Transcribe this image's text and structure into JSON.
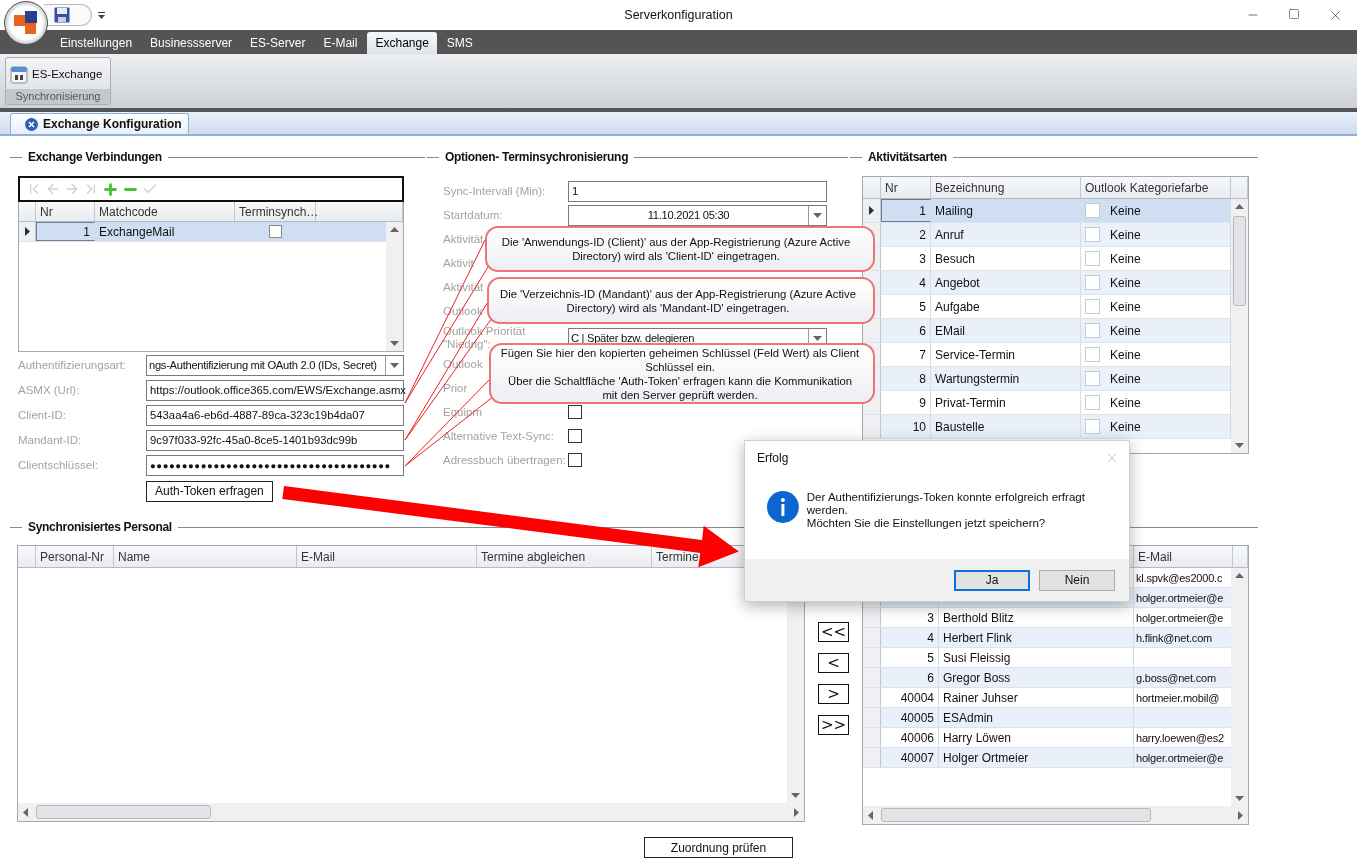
{
  "window": {
    "title": "Serverkonfiguration"
  },
  "ribbon": {
    "tabs": [
      {
        "label": "Einstellungen",
        "selected": false
      },
      {
        "label": "Businessserver",
        "selected": false
      },
      {
        "label": "ES-Server",
        "selected": false
      },
      {
        "label": "E-Mail",
        "selected": false
      },
      {
        "label": "Exchange",
        "selected": true
      },
      {
        "label": "SMS",
        "selected": false
      }
    ],
    "group": {
      "label": "Synchronisierung",
      "button": "ES-Exchange"
    }
  },
  "document_tabs": [
    {
      "label": "Exchange Konfiguration",
      "selected": true
    }
  ],
  "exchange_connections": {
    "title": "Exchange Verbindungen",
    "columns": [
      "Nr",
      "Matchcode",
      "Terminsynch…"
    ],
    "rows": [
      {
        "nr": "1",
        "matchcode": "ExchangeMail",
        "terminsync": false,
        "selected": true
      }
    ]
  },
  "connection_fields": [
    {
      "label": "Authentifizierungsart:",
      "kind": "dropdown",
      "value": "ngs-Authentifizierung mit OAuth 2.0 (IDs, Secret)"
    },
    {
      "label": "ASMX (Url):",
      "kind": "text",
      "value": "https://outlook.office365.com/EWS/Exchange.asmx"
    },
    {
      "label": "Client-ID:",
      "kind": "text",
      "value": "543aa4a6-eb6d-4887-89ca-323c19b4da07"
    },
    {
      "label": "Mandant-ID:",
      "kind": "text",
      "value": "9c97f033-92fc-45a0-8ce5-1401b93dc99b"
    },
    {
      "label": "Clientschlüssel:",
      "kind": "password",
      "value": "●●●●●●●●●●●●●●●●●●●●●●●●●●●●●●●●●●●●●●"
    }
  ],
  "auth_button": "Auth-Token erfragen",
  "sync_options": {
    "title": "Optionen- Terminsychronisierung",
    "fields": [
      {
        "label": "Sync-Intervall (Min):",
        "kind": "text",
        "value": "1"
      },
      {
        "label": "Startdatum:",
        "kind": "date",
        "value": "11.10.2021 05:30"
      },
      {
        "label": "Aktivität",
        "kind": "label"
      },
      {
        "label": "Aktivit",
        "kind": "label"
      },
      {
        "label": "Aktivität",
        "kind": "label"
      },
      {
        "label": "Outlook",
        "kind": "label"
      },
      {
        "label": "Outlook Priorität\n\"Niedrig\":",
        "kind": "dropdown",
        "value": "C | Später bzw. delegieren"
      },
      {
        "label": "Outlook",
        "kind": "label"
      },
      {
        "label": "Prior",
        "kind": "label"
      },
      {
        "label": "Equipm",
        "kind": "checkbox",
        "checked": false
      },
      {
        "label": "Alternative Text-Sync:",
        "kind": "checkbox",
        "checked": false
      },
      {
        "label": "Adressbuch übertragen:",
        "kind": "checkbox",
        "checked": false
      }
    ]
  },
  "activity_types": {
    "title": "Aktivitätsarten",
    "columns": [
      "Nr",
      "Bezeichnung",
      "Outlook Kategoriefarbe"
    ],
    "rows": [
      {
        "nr": "1",
        "name": "Mailing",
        "category": "Keine",
        "selected": true
      },
      {
        "nr": "2",
        "name": "Anruf",
        "category": "Keine",
        "selected": false
      },
      {
        "nr": "3",
        "name": "Besuch",
        "category": "Keine",
        "selected": false
      },
      {
        "nr": "4",
        "name": "Angebot",
        "category": "Keine",
        "selected": false
      },
      {
        "nr": "5",
        "name": "Aufgabe",
        "category": "Keine",
        "selected": false
      },
      {
        "nr": "6",
        "name": "EMail",
        "category": "Keine",
        "selected": false
      },
      {
        "nr": "7",
        "name": "Service-Termin",
        "category": "Keine",
        "selected": false
      },
      {
        "nr": "8",
        "name": "Wartungstermin",
        "category": "Keine",
        "selected": false
      },
      {
        "nr": "9",
        "name": "Privat-Termin",
        "category": "Keine",
        "selected": false
      },
      {
        "nr": "10",
        "name": "Baustelle",
        "category": "Keine",
        "selected": false
      }
    ]
  },
  "synced_staff": {
    "title": "Synchronisiertes Personal",
    "columns": [
      "Personal-Nr",
      "Name",
      "E-Mail",
      "Termine abgleichen",
      "Termine"
    ]
  },
  "transfer_buttons": [
    "<<",
    "<",
    ">",
    ">>"
  ],
  "staff": {
    "columns": [
      "E-Mail"
    ],
    "rows": [
      {
        "email": "kl.spvk@es2000.c"
      },
      {
        "email": "holger.ortmeier@e"
      },
      {
        "nr": "3",
        "name": "Berthold Blitz",
        "email": "holger.ortmeier@e"
      },
      {
        "nr": "4",
        "name": "Herbert Flink",
        "email": "h.flink@net.com"
      },
      {
        "nr": "5",
        "name": "Susi Fleissig"
      },
      {
        "nr": "6",
        "name": "Gregor Boss",
        "email": "g.boss@net.com"
      },
      {
        "nr": "40004",
        "name": "Rainer Juhser",
        "email": "hortmeier.mobil@"
      },
      {
        "nr": "40005",
        "name": "ESAdmin"
      },
      {
        "nr": "40006",
        "name": "Harry Löwen",
        "email": "harry.loewen@es2"
      },
      {
        "nr": "40007",
        "name": "Holger Ortmeier",
        "email": "holger.ortmeier@e"
      }
    ]
  },
  "check_button": "Zuordnung prüfen",
  "callouts": [
    {
      "paragraphs": [
        "Die 'Anwendungs-ID (Client)' aus der App-Registrierung (Azure Active Directory) wird als 'Client-ID' eingetragen."
      ]
    },
    {
      "paragraphs": [
        "Die 'Verzeichnis-ID (Mandant)' aus der App-Registrierung (Azure Active Directory) wird als 'Mandant-ID' eingetragen."
      ]
    },
    {
      "paragraphs": [
        "Fügen Sie hier den kopierten geheimen Schlüssel (Feld Wert) als Client Schlüssel ein.",
        "Über die Schaltfläche 'Auth-Token' erfragen kann die Kommunikation mit den Server geprüft werden."
      ]
    }
  ],
  "dialog": {
    "title": "Erfolg",
    "message": [
      "Der Authentifizierungs-Token konnte erfolgreich erfragt werden.",
      "Möchten Sie die Einstellungen jetzt speichern?"
    ],
    "buttons": [
      {
        "label": "Ja",
        "default": true
      },
      {
        "label": "Nein",
        "default": false
      }
    ]
  }
}
